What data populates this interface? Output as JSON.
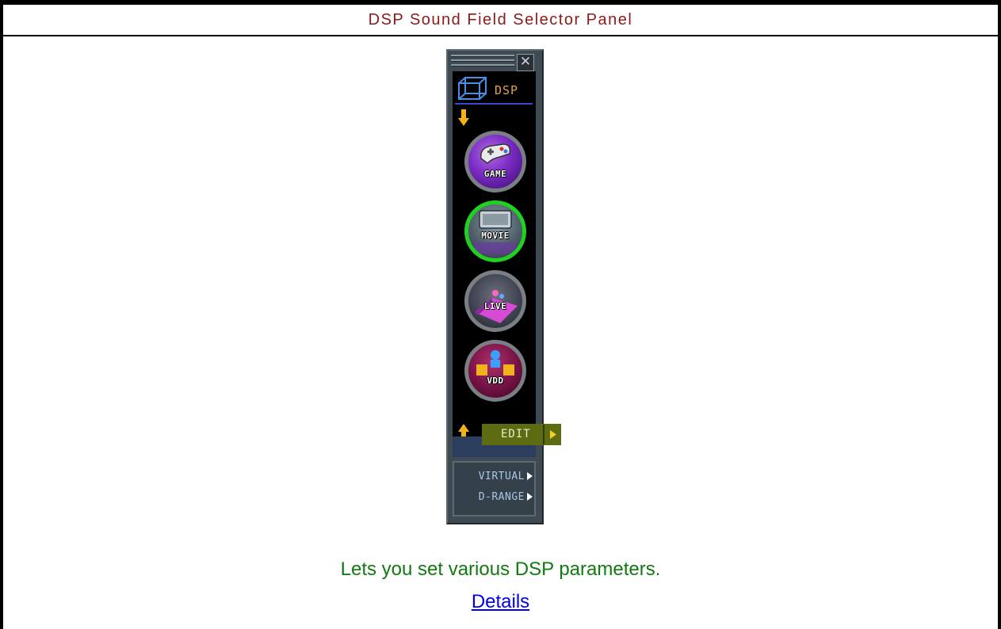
{
  "page": {
    "title": "DSP Sound Field Selector Panel",
    "description": "Lets you set various DSP parameters.",
    "details_link": "Details"
  },
  "panel": {
    "header_label": "DSP",
    "close_icon": "close-icon",
    "modes": [
      {
        "label": "GAME",
        "icon": "game-controller-icon",
        "selected": false
      },
      {
        "label": "MOVIE",
        "icon": "movie-screen-icon",
        "selected": true
      },
      {
        "label": "LIVE",
        "icon": "live-stage-icon",
        "selected": false
      },
      {
        "label": "VDD",
        "icon": "virtual-dolby-digital-icon",
        "selected": false
      }
    ],
    "edit_label": "EDIT",
    "options": [
      {
        "label": "VIRTUAL"
      },
      {
        "label": "D-RANGE"
      }
    ]
  },
  "colors": {
    "title_text": "#8b1a1a",
    "description_text": "#117a11",
    "link": "#0000ee",
    "selected_ring": "#1fd21f",
    "accent_orange": "#e7a33e"
  }
}
